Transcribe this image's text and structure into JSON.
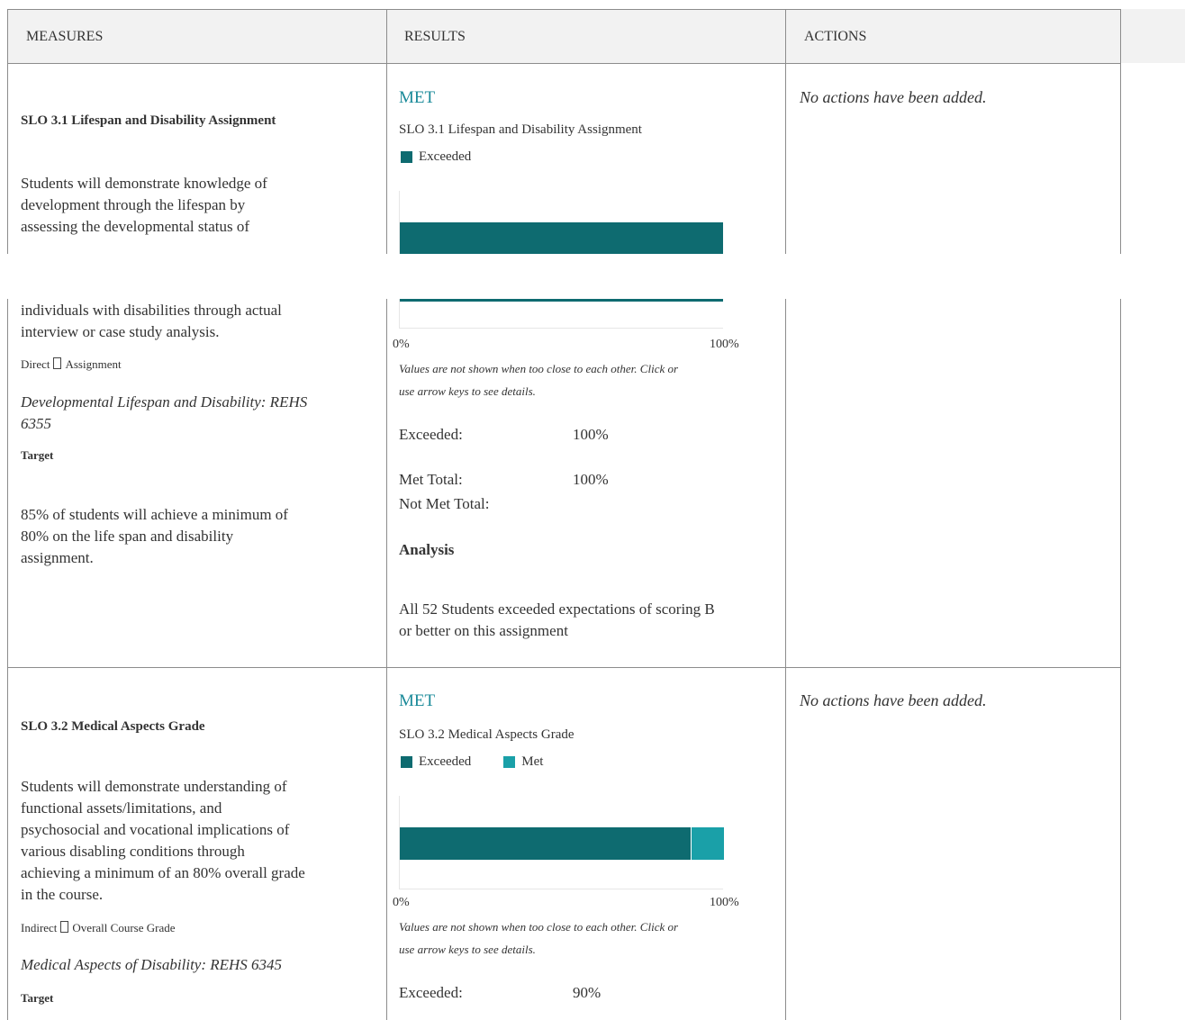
{
  "header": {
    "measures": "MEASURES",
    "results": "RESULTS",
    "actions": "ACTIONS"
  },
  "colors": {
    "exceeded": "#0e6b70",
    "met": "#1aa0a8",
    "met_status": "#1a8a99",
    "border": "#8c8c8c"
  },
  "rows": [
    {
      "slo_title": "SLO 3.1 Lifespan and Disability Assignment",
      "description_lines": [
        "Students will demonstrate knowledge of",
        "development through the lifespan by",
        "assessing the developmental status of",
        "individuals with disabilities through actual",
        "interview or case study analysis."
      ],
      "measure_type": "Direct",
      "measure_method": "Assignment",
      "course_lines": [
        "Developmental Lifespan and Disability: REHS",
        "6355"
      ],
      "target_label": "Target",
      "target_lines": [
        "85% of students will achieve a minimum of",
        "80% on the life span and disability",
        "assignment."
      ],
      "status": "MET",
      "chart_data": {
        "type": "bar",
        "orientation": "horizontal-stacked",
        "title": "SLO 3.1 Lifespan and Disability Assignment",
        "series": [
          {
            "name": "Exceeded",
            "values": [
              100
            ]
          }
        ],
        "xlim": [
          0,
          100
        ],
        "tick_labels": [
          "0%",
          "100%"
        ],
        "legend": "top-left"
      },
      "note_lines": [
        "Values are not shown when too close to each other.   Click or",
        "use arrow keys to see details."
      ],
      "results": [
        {
          "label": "Exceeded:",
          "value": "100%"
        },
        {
          "label": "Met Total:",
          "value": "100%"
        },
        {
          "label": "Not Met Total:",
          "value": ""
        }
      ],
      "analysis_label": "Analysis",
      "analysis_lines": [
        "All 52 Students exceeded expectations of scoring B",
        "or better on this assignment"
      ],
      "actions_text": "No actions have been added."
    },
    {
      "slo_title": "SLO 3.2 Medical Aspects Grade",
      "description_lines": [
        "Students will demonstrate understanding of",
        "functional assets/limitations, and",
        "psychosocial and vocational implications of",
        "various disabling conditions through",
        "achieving a minimum of an 80% overall grade",
        "in the course."
      ],
      "measure_type": "Indirect",
      "measure_method": "Overall Course Grade",
      "course_lines": [
        "Medical Aspects of Disability: REHS 6345"
      ],
      "target_label": "Target",
      "status": "MET",
      "chart_data": {
        "type": "bar",
        "orientation": "horizontal-stacked",
        "title": "SLO 3.2 Medical Aspects Grade",
        "series": [
          {
            "name": "Exceeded",
            "values": [
              90
            ]
          },
          {
            "name": "Met",
            "values": [
              10
            ]
          }
        ],
        "xlim": [
          0,
          100
        ],
        "tick_labels": [
          "0%",
          "100%"
        ],
        "legend": "top-left"
      },
      "note_lines": [
        "Values are not shown when too close to each other.   Click or",
        "use arrow keys to see details."
      ],
      "results": [
        {
          "label": "Exceeded:",
          "value": "90%"
        }
      ],
      "actions_text": "No actions have been added."
    }
  ]
}
